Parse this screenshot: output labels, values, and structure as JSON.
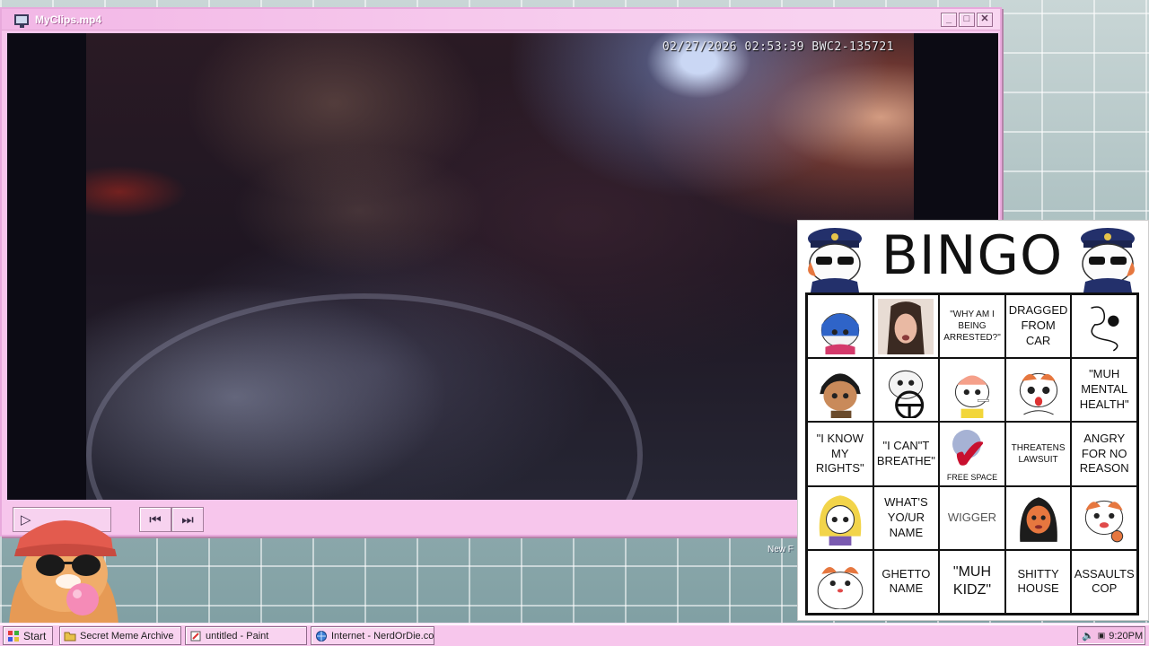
{
  "window": {
    "title": "MyClips.mp4",
    "minimize_glyph": "_",
    "maximize_glyph": "□",
    "close_glyph": "✕"
  },
  "video": {
    "timestamp": "02/27/2026 02:53:39 BWC2-135721"
  },
  "controls": {
    "play_icon": "play-icon",
    "prev_icon": "skip-back-icon",
    "next_icon": "skip-forward-icon",
    "play_glyph": "▷",
    "prev_glyph": "⏮",
    "next_glyph": "⏭"
  },
  "desktop": {
    "partial_label": "New F"
  },
  "bingo": {
    "title": "BINGO",
    "cells": [
      {
        "text": "",
        "image": "cat-with-headscarf"
      },
      {
        "text": "",
        "image": "crying-woman-photo"
      },
      {
        "text": "\"WHY AM I\nBEING\nARRESTED?\"",
        "style": "small"
      },
      {
        "text": "DRAGGED\nFROM\nCAR",
        "style": ""
      },
      {
        "text": "",
        "image": "swirl-line-drawing"
      },
      {
        "text": "",
        "image": "cat-with-curly-hair"
      },
      {
        "text": "",
        "image": "cat-driving"
      },
      {
        "text": "",
        "image": "cat-smoking"
      },
      {
        "text": "",
        "image": "cat-shocked"
      },
      {
        "text": "\"MUH\nMENTAL\nHEALTH\"",
        "style": ""
      },
      {
        "text": "\"I KNOW\nMY\nRIGHTS\"",
        "style": ""
      },
      {
        "text": "\"I CAN\"T\nBREATHE\"",
        "style": ""
      },
      {
        "text": "FREE SPACE",
        "style": "free"
      },
      {
        "text": "THREATENS\nLAWSUIT",
        "style": "small"
      },
      {
        "text": "ANGRY\nFOR NO\nREASON",
        "style": ""
      },
      {
        "text": "",
        "image": "blonde-cat"
      },
      {
        "text": "WHAT'S\nYO/UR\nNAME",
        "style": ""
      },
      {
        "text": "WIGGER",
        "style": "gray"
      },
      {
        "text": "",
        "image": "cat-in-hijab"
      },
      {
        "text": "",
        "image": "cat-with-bottle"
      },
      {
        "text": "",
        "image": "chubby-cat"
      },
      {
        "text": "GHETTO\nNAME",
        "style": ""
      },
      {
        "text": "\"MUH\nKIDZ\"",
        "style": "big"
      },
      {
        "text": "SHITTY\nHOUSE",
        "style": ""
      },
      {
        "text": "ASSAULTS\nCOP",
        "style": ""
      }
    ]
  },
  "taskbar": {
    "start_label": "Start",
    "tasks": [
      {
        "label": "Secret Meme Archive",
        "icon": "folder-icon"
      },
      {
        "label": "untitled - Paint",
        "icon": "paint-icon"
      },
      {
        "label": "Internet - NerdOrDie.com",
        "icon": "internet-icon"
      }
    ],
    "clock": "9:20PM"
  },
  "colors": {
    "window_bg": "#f7c6ec",
    "accent": "#c8102e"
  }
}
